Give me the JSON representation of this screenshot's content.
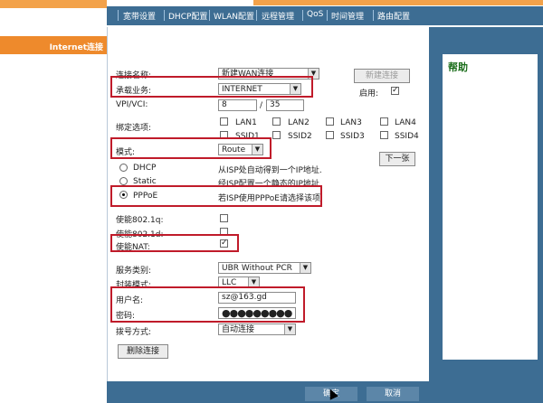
{
  "nav": {
    "items": [
      "宽带设置",
      "DHCP配置",
      "WLAN配置",
      "远程管理",
      "QoS",
      "时间管理",
      "路由配置"
    ]
  },
  "sidebar": {
    "internet_label": "Internet连接"
  },
  "help": {
    "title": "帮助"
  },
  "form": {
    "conn_name_label": "连接名称:",
    "conn_name_value": "新建WAN连接",
    "new_conn_button": "新建连接",
    "service_label": "承载业务:",
    "service_value": "INTERNET",
    "enable_label": "启用:",
    "vpi_label": "VPI/VCI:",
    "vpi_value": "8",
    "vci_sep": "/",
    "vci_value": "35",
    "bind_label": "绑定选项:",
    "bind_options": [
      "LAN1",
      "LAN2",
      "LAN3",
      "LAN4",
      "SSID1",
      "SSID2",
      "SSID3",
      "SSID4"
    ],
    "mode_label": "模式:",
    "mode_value": "Route",
    "next_button": "下一张",
    "dhcp_label": "DHCP",
    "dhcp_desc": "从ISP处自动得到一个IP地址.",
    "static_label": "Static",
    "static_desc": "经ISP配置一个静态的IP地址",
    "pppoe_label": "PPPoE",
    "pppoe_desc": "若ISP使用PPPoE请选择该项",
    "vlan_label": "使能802.1q:",
    "8021d_label": "使能802.1d:",
    "nat_label": "使能NAT:",
    "service_class_label": "服务类别:",
    "service_class_value": "UBR Without PCR",
    "encap_label": "封装模式:",
    "encap_value": "LLC",
    "username_label": "用户名:",
    "username_value": "sz@163.gd",
    "password_label": "密码:",
    "password_value": "●●●●●●●●●",
    "dial_label": "拨号方式:",
    "dial_value": "自动连接",
    "delete_button": "删除连接"
  },
  "bottom": {
    "ok": "确定",
    "cancel": "取消"
  }
}
